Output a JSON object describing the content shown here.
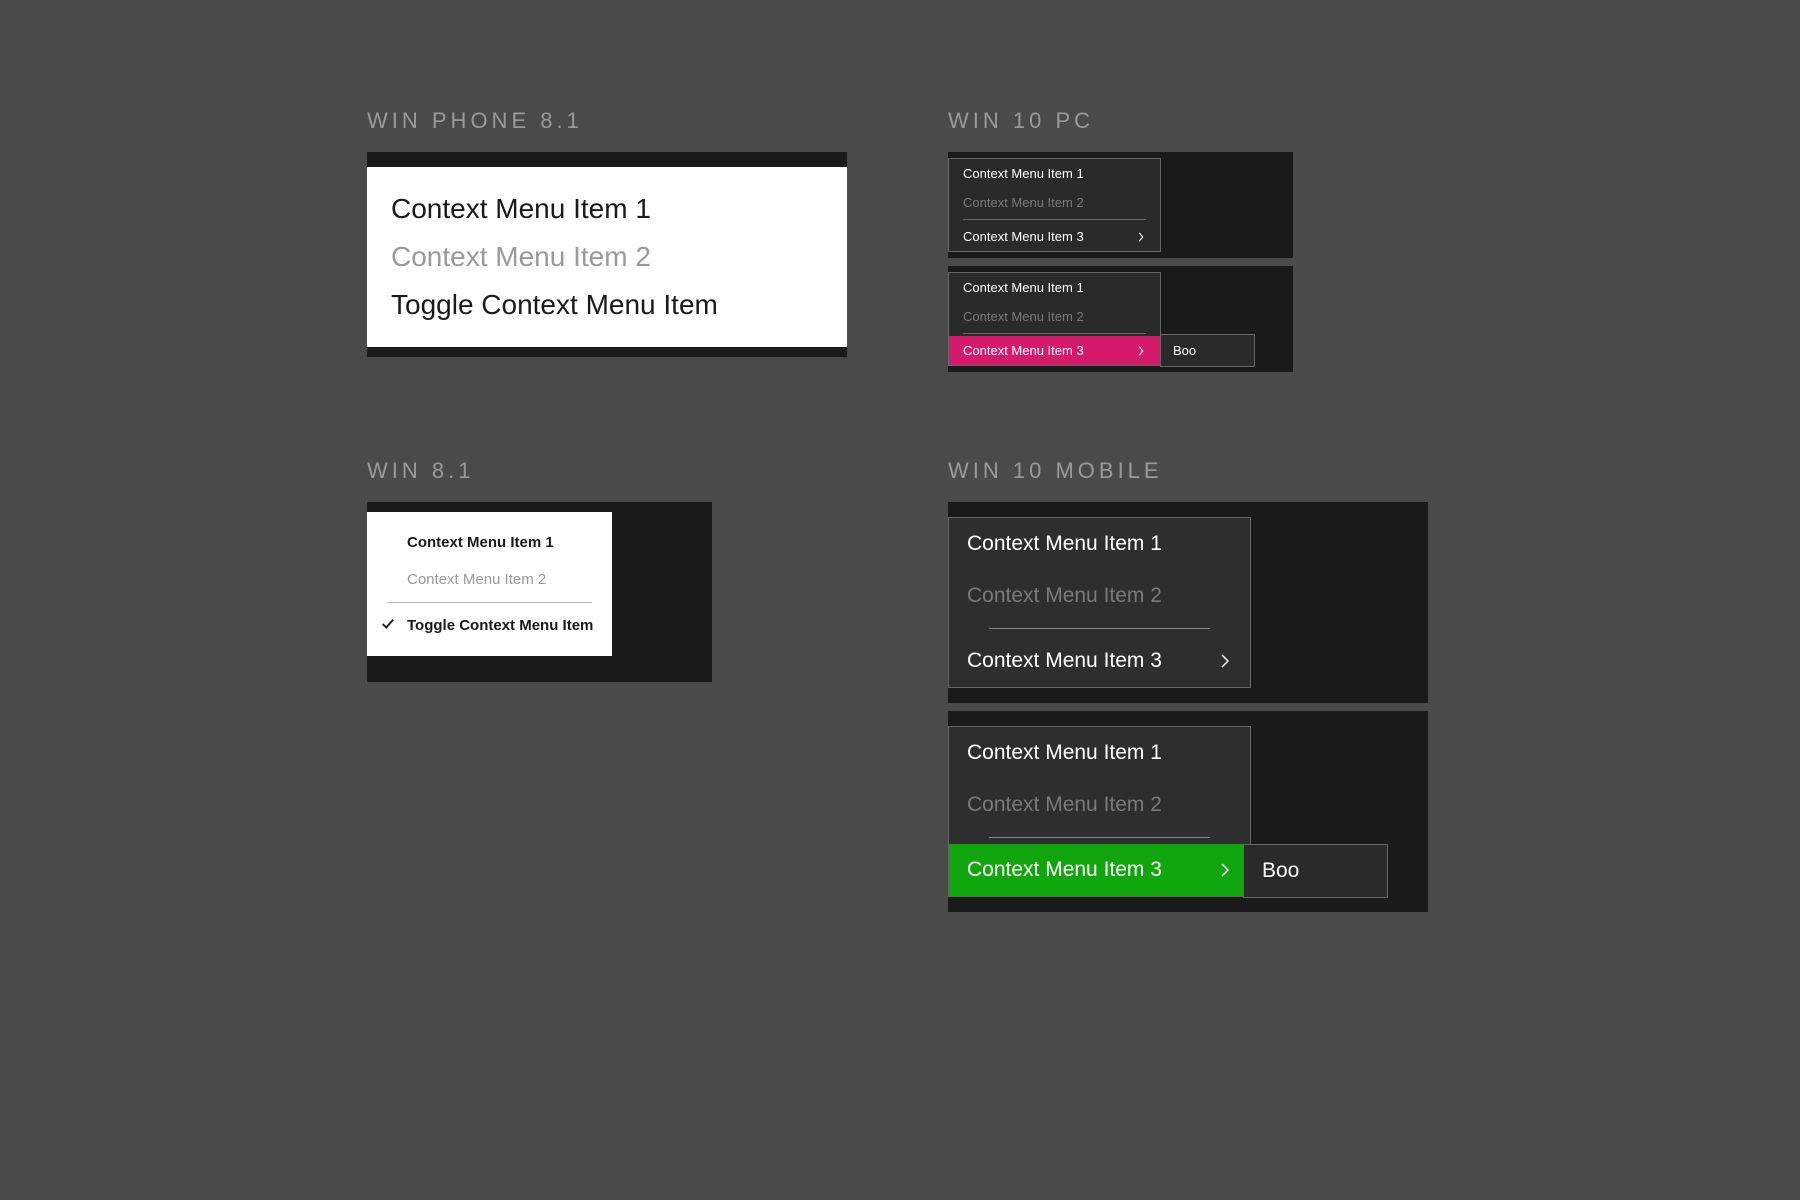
{
  "colors": {
    "hover_pink": "#d61a6b",
    "hover_green": "#12a60e"
  },
  "winphone81": {
    "title": "WIN PHONE 8.1",
    "items": [
      {
        "label": "Context Menu Item 1"
      },
      {
        "label": "Context Menu Item 2"
      },
      {
        "label": "Toggle Context Menu Item"
      }
    ]
  },
  "win81": {
    "title": "WIN 8.1",
    "items": [
      {
        "label": "Context Menu Item 1"
      },
      {
        "label": "Context Menu Item 2"
      },
      {
        "label": "Toggle Context Menu Item"
      }
    ]
  },
  "win10pc": {
    "title": "WIN 10 PC",
    "menu1": {
      "items": [
        {
          "label": "Context Menu Item 1"
        },
        {
          "label": "Context Menu Item 2"
        },
        {
          "label": "Context Menu Item 3"
        }
      ]
    },
    "menu2": {
      "items": [
        {
          "label": "Context Menu Item 1"
        },
        {
          "label": "Context Menu Item 2"
        },
        {
          "label": "Context Menu Item 3"
        }
      ],
      "submenu_label": "Boo"
    }
  },
  "win10mobile": {
    "title": "WIN 10 MOBILE",
    "menu1": {
      "items": [
        {
          "label": "Context Menu Item 1"
        },
        {
          "label": "Context Menu Item 2"
        },
        {
          "label": "Context Menu Item 3"
        }
      ]
    },
    "menu2": {
      "items": [
        {
          "label": "Context Menu Item 1"
        },
        {
          "label": "Context Menu Item 2"
        },
        {
          "label": "Context Menu Item 3"
        }
      ],
      "submenu_label": "Boo"
    }
  }
}
